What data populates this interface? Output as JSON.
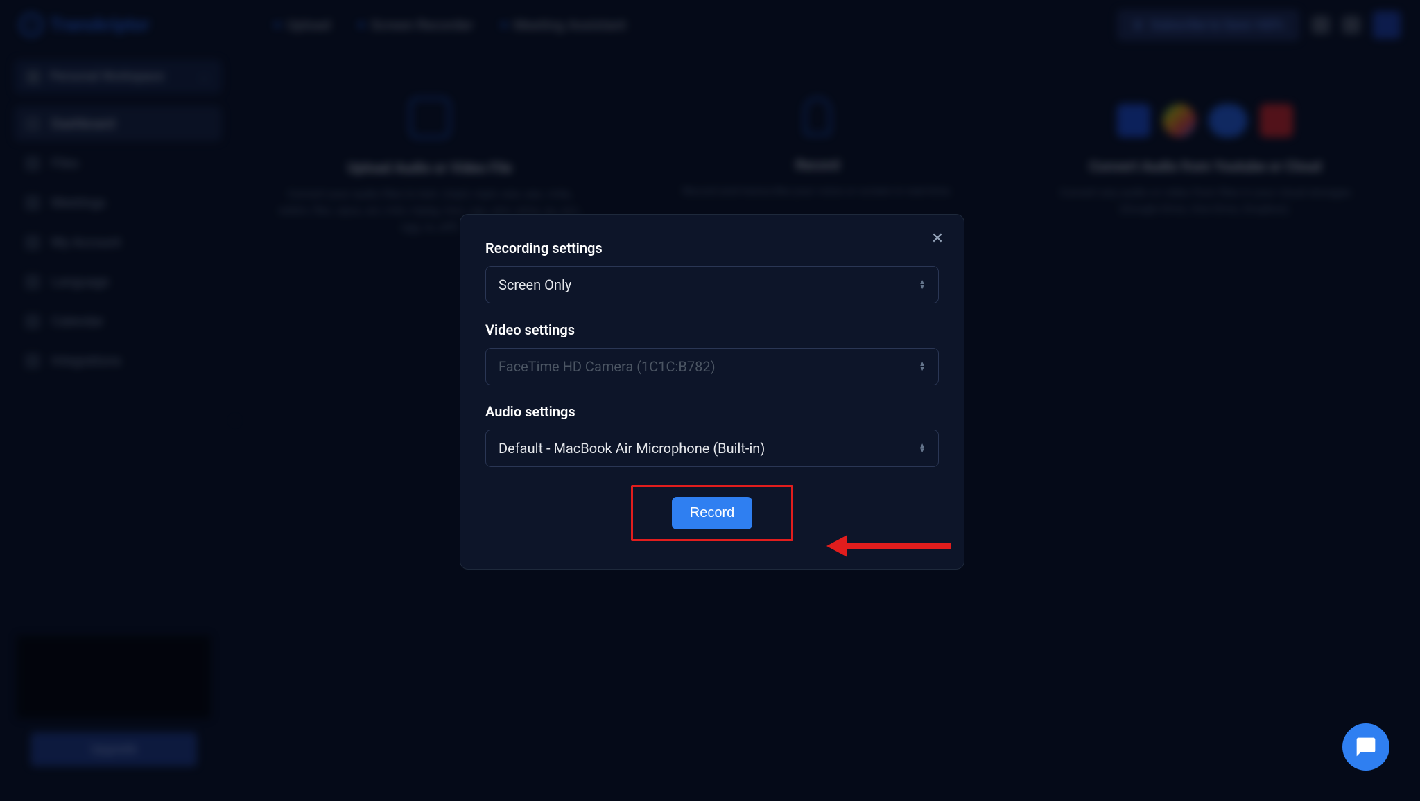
{
  "brand": "Transkriptor",
  "header": {
    "tabs": [
      {
        "label": "Upload",
        "active": false
      },
      {
        "label": "Screen Recorder",
        "active": true
      },
      {
        "label": "Meeting Assistant",
        "active": false
      }
    ],
    "subscribe": "Subscribe to Save +60%"
  },
  "sidebar": {
    "workspace": "Personal Workspace",
    "items": [
      {
        "label": "Dashboard",
        "active": true
      },
      {
        "label": "Files",
        "active": false
      },
      {
        "label": "Meetings",
        "active": false
      },
      {
        "label": "My Account",
        "active": false
      },
      {
        "label": "Language",
        "active": false
      },
      {
        "label": "Calendar",
        "active": false
      },
      {
        "label": "Integrations",
        "active": false
      }
    ],
    "upgrade": "Upgrade"
  },
  "cards": {
    "upload": {
      "title": "Upload Audio or Video File",
      "desc": "Convert your audio files to text. (mp3, mp4, wav, aac, m4a, webm, flac, opus, avi, m4v, mpeg, mov, ogv, amr, wma, au, acc, ogg, ra, aiff)"
    },
    "record": {
      "title": "Record",
      "desc": "Record and transcribe your voice or screen in real-time."
    },
    "cloud": {
      "title": "Convert Audio from Youtube or Cloud",
      "desc": "Convert any audio or video from files in your cloud storages (Google Drive, One Drive, Dropbox)."
    }
  },
  "modal": {
    "recording_label": "Recording settings",
    "recording_value": "Screen Only",
    "video_label": "Video settings",
    "video_value": "FaceTime HD Camera (1C1C:B782)",
    "audio_label": "Audio settings",
    "audio_value": "Default - MacBook Air Microphone (Built-in)",
    "record_button": "Record"
  }
}
